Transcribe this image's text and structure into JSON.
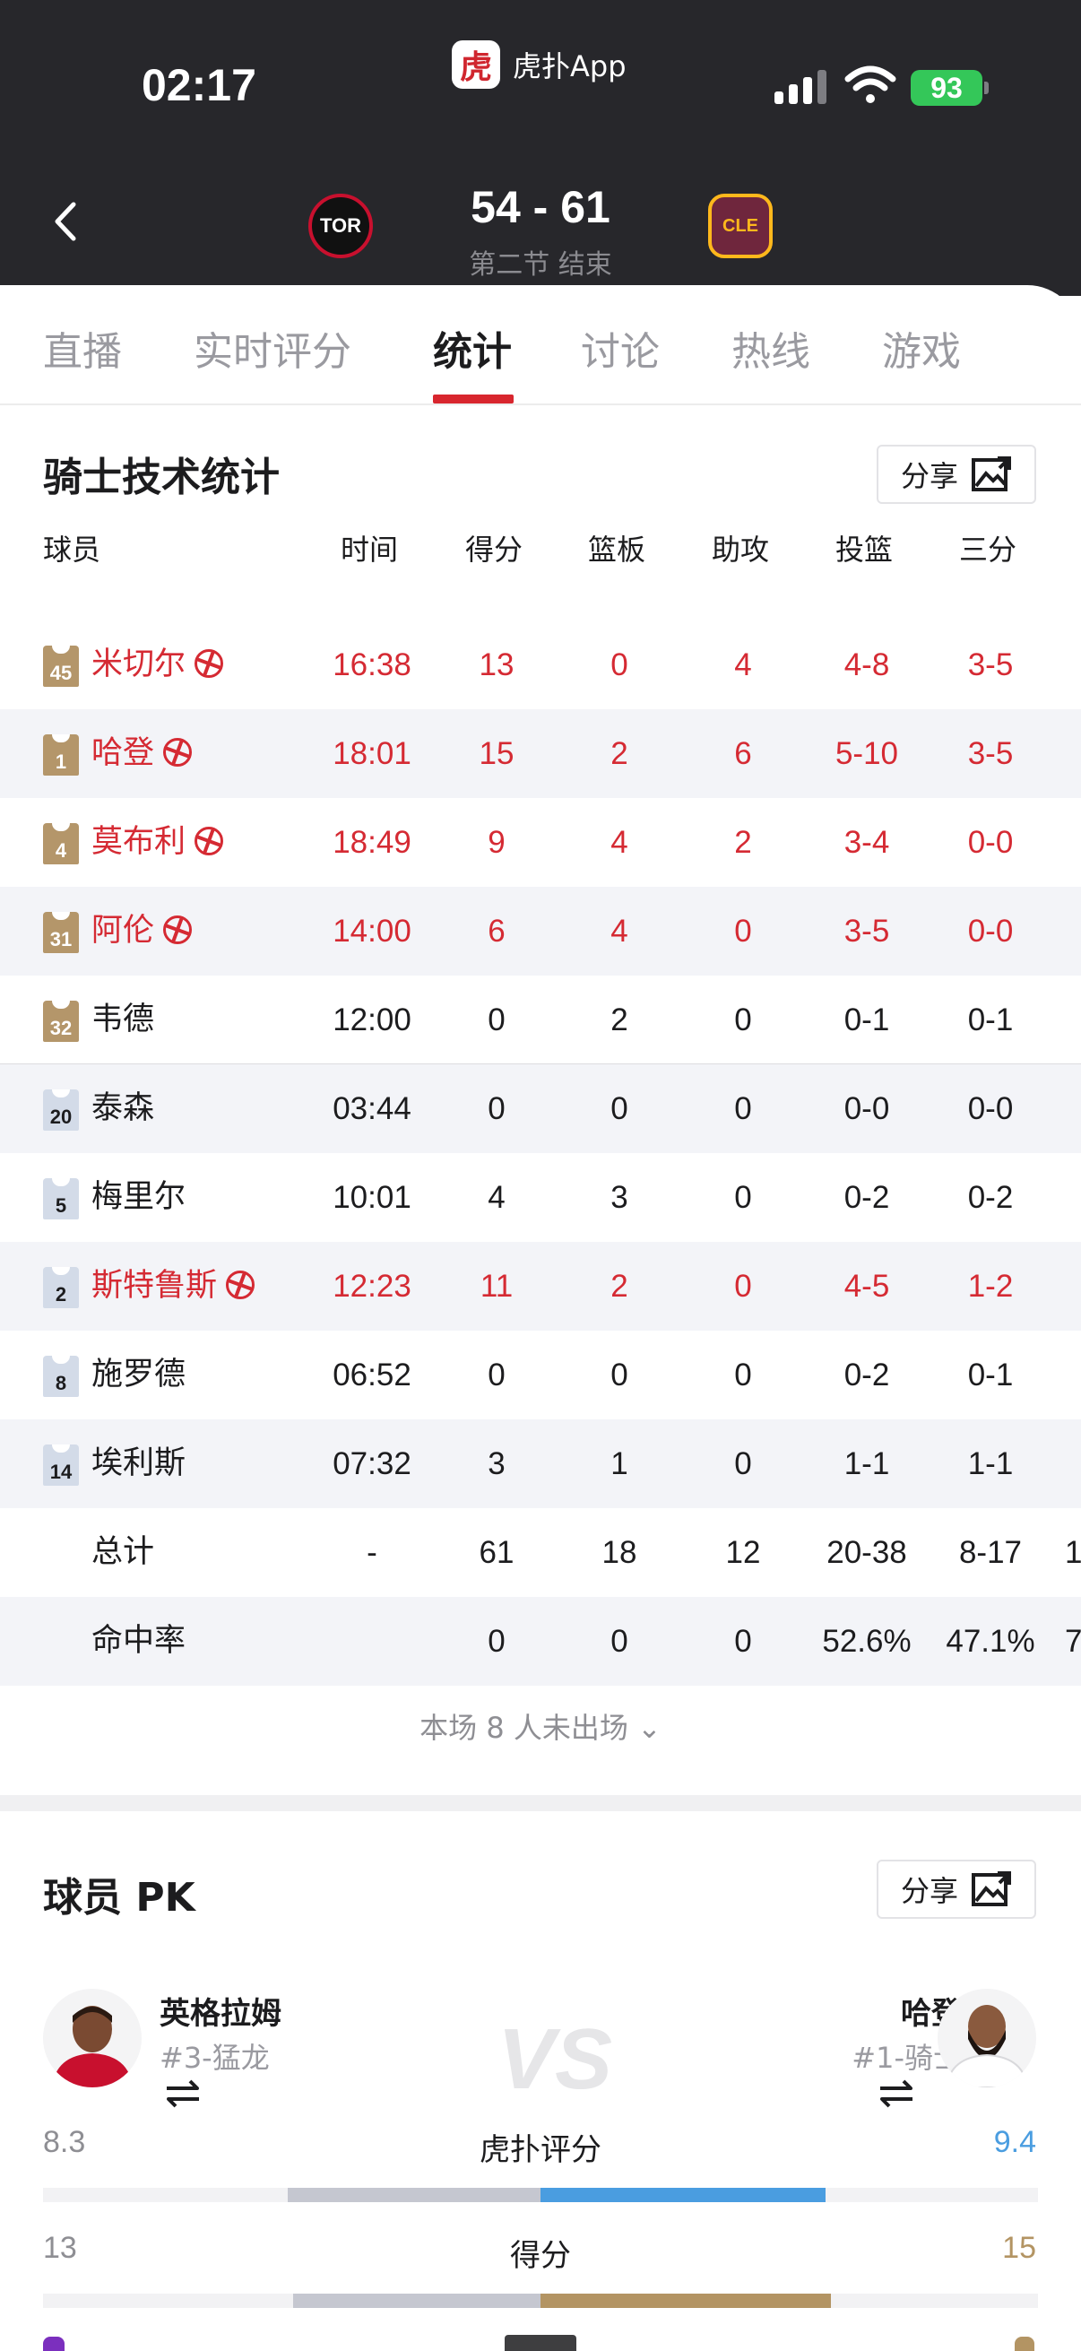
{
  "status_bar": {
    "time": "02:17",
    "app_name": "虎扑App",
    "app_logo_char": "虎",
    "battery": "93"
  },
  "game": {
    "home_logo_text": "TOR",
    "away_logo_text": "CLE",
    "score": "54 - 61",
    "period": "第二节 结束"
  },
  "tabs": [
    "直播",
    "实时评分",
    "统计",
    "讨论",
    "热线",
    "游戏"
  ],
  "active_tab": "统计",
  "stats": {
    "title": "骑士技术统计",
    "share_label": "分享",
    "headers": [
      "球员",
      "时间",
      "得分",
      "篮板",
      "助攻",
      "投篮",
      "三分"
    ],
    "players": [
      {
        "number": "45",
        "name": "米切尔",
        "hot": true,
        "starter": true,
        "time": "16:38",
        "pts": "13",
        "reb": "0",
        "ast": "4",
        "fg": "4-8",
        "tp": "3-5"
      },
      {
        "number": "1",
        "name": "哈登",
        "hot": true,
        "starter": true,
        "time": "18:01",
        "pts": "15",
        "reb": "2",
        "ast": "6",
        "fg": "5-10",
        "tp": "3-5"
      },
      {
        "number": "4",
        "name": "莫布利",
        "hot": true,
        "starter": true,
        "time": "18:49",
        "pts": "9",
        "reb": "4",
        "ast": "2",
        "fg": "3-4",
        "tp": "0-0"
      },
      {
        "number": "31",
        "name": "阿伦",
        "hot": true,
        "starter": true,
        "time": "14:00",
        "pts": "6",
        "reb": "4",
        "ast": "0",
        "fg": "3-5",
        "tp": "0-0"
      },
      {
        "number": "32",
        "name": "韦德",
        "hot": false,
        "starter": true,
        "time": "12:00",
        "pts": "0",
        "reb": "2",
        "ast": "0",
        "fg": "0-1",
        "tp": "0-1"
      },
      {
        "number": "20",
        "name": "泰森",
        "hot": false,
        "starter": false,
        "time": "03:44",
        "pts": "0",
        "reb": "0",
        "ast": "0",
        "fg": "0-0",
        "tp": "0-0"
      },
      {
        "number": "5",
        "name": "梅里尔",
        "hot": false,
        "starter": false,
        "time": "10:01",
        "pts": "4",
        "reb": "3",
        "ast": "0",
        "fg": "0-2",
        "tp": "0-2"
      },
      {
        "number": "2",
        "name": "斯特鲁斯",
        "hot": true,
        "starter": false,
        "time": "12:23",
        "pts": "11",
        "reb": "2",
        "ast": "0",
        "fg": "4-5",
        "tp": "1-2"
      },
      {
        "number": "8",
        "name": "施罗德",
        "hot": false,
        "starter": false,
        "time": "06:52",
        "pts": "0",
        "reb": "0",
        "ast": "0",
        "fg": "0-2",
        "tp": "0-1"
      },
      {
        "number": "14",
        "name": "埃利斯",
        "hot": false,
        "starter": false,
        "time": "07:32",
        "pts": "3",
        "reb": "1",
        "ast": "0",
        "fg": "1-1",
        "tp": "1-1"
      }
    ],
    "total": {
      "label": "总计",
      "time": "-",
      "pts": "61",
      "reb": "18",
      "ast": "12",
      "fg": "20-38",
      "tp": "8-17",
      "overflow": "1"
    },
    "pct": {
      "label": "命中率",
      "pts": "0",
      "reb": "0",
      "ast": "0",
      "fg": "52.6%",
      "tp": "47.1%",
      "overflow": "7"
    },
    "absent_text": "本场 8 人未出场",
    "absent_chevron": "⌄"
  },
  "pk": {
    "title": "球员 PK",
    "share_label": "分享",
    "vs_text": "VS",
    "left": {
      "name": "英格拉姆",
      "team": "#3-猛龙"
    },
    "right": {
      "name": "哈登",
      "team": "#1-骑士"
    },
    "metrics": [
      {
        "label": "虎扑评分",
        "left": "8.3",
        "right": "9.4",
        "left_fraction": 0.47,
        "right_fraction": 0.53,
        "right_color": "#4a9de0"
      },
      {
        "label": "得分",
        "left": "13",
        "right": "15",
        "left_fraction": 0.46,
        "right_fraction": 0.54,
        "right_color": "#b39463"
      }
    ]
  },
  "icons": {
    "back": "chevron-left-icon",
    "share": "image-share-icon",
    "swap": "swap-arrows-icon",
    "hot": "basketball-icon"
  },
  "colors": {
    "accent_red": "#d52a33",
    "header_bg": "#27272b",
    "gold": "#b39463",
    "blue": "#4a9de0"
  }
}
